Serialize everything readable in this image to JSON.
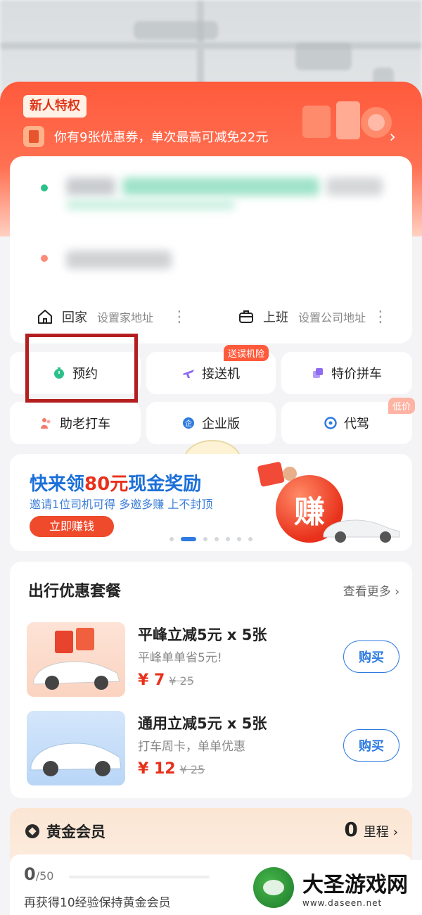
{
  "promo": {
    "tag": "新人特权",
    "coupon_text": "你有9张优惠券，单次最高可减免22元"
  },
  "shortcuts": [
    {
      "label": "回家",
      "sub": "设置家地址"
    },
    {
      "label": "上班",
      "sub": "设置公司地址"
    }
  ],
  "services": {
    "row1": [
      {
        "label": "预约"
      },
      {
        "label": "接送机",
        "badge": "送误机险"
      },
      {
        "label": "特价拼车"
      }
    ],
    "row2": [
      {
        "label": "助老打车"
      },
      {
        "label": "企业版"
      },
      {
        "label": "代驾",
        "badge": "低价"
      }
    ]
  },
  "banner": {
    "title_prefix": "快来领",
    "title_amount": "80元",
    "title_suffix": "现金奖励",
    "subtitle": "邀请1位司机可得 多邀多赚 上不封顶",
    "button": "立即赚钱",
    "ball_text": "赚"
  },
  "packages": {
    "title": "出行优惠套餐",
    "more": "查看更多",
    "items": [
      {
        "name": "平峰立减5元 x 5张",
        "desc": "平峰单单省5元!",
        "price": "¥ 7",
        "original": "¥ 25",
        "button": "购买"
      },
      {
        "name": "通用立减5元 x 5张",
        "desc": "打车周卡，单单优惠",
        "price": "¥ 12",
        "original": "¥ 25",
        "button": "购买"
      }
    ]
  },
  "gold": {
    "title": "黄金会员",
    "points": "0",
    "points_unit": "里程",
    "progress_value": "0",
    "progress_total": "/50",
    "note": "再获得10经验保持黄金会员"
  },
  "watermark": {
    "name": "大圣游戏网",
    "url": "www.daseen.net"
  },
  "colors": {
    "accent_orange": "#ff5a3c",
    "primary_blue": "#2f7be0",
    "highlight_red": "#b41e1e"
  }
}
